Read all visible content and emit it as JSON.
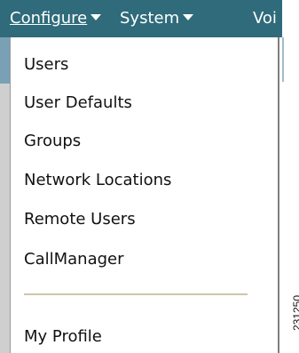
{
  "menubar": {
    "items": [
      {
        "label": "Configure",
        "active": true
      },
      {
        "label": "System"
      },
      {
        "label": "Voi"
      }
    ]
  },
  "dropdown": {
    "items": [
      {
        "label": "Users"
      },
      {
        "label": "User Defaults"
      },
      {
        "label": "Groups"
      },
      {
        "label": "Network Locations"
      },
      {
        "label": "Remote Users"
      },
      {
        "label": "CallManager"
      },
      {
        "label": "My Profile"
      }
    ]
  },
  "figure_id": "231250",
  "colors": {
    "menubar_bg": "#2f6b7a",
    "menu_text": "#111111",
    "separator": "#cfc6a9"
  },
  "icons": {
    "dropdown_arrow": "caret-down-icon"
  }
}
